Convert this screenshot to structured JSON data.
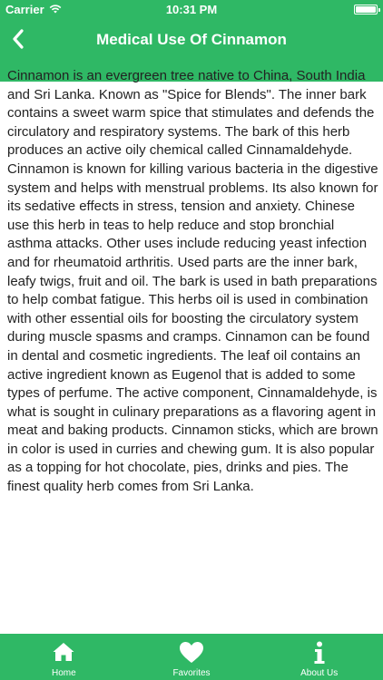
{
  "status_bar": {
    "carrier": "Carrier",
    "time": "10:31 PM",
    "wifi_icon": "wifi-icon",
    "battery_icon": "battery-icon"
  },
  "nav": {
    "title": "Medical Use Of Cinnamon",
    "back_icon": "chevron-left-icon"
  },
  "article": {
    "body": "Cinnamon is an evergreen tree native to China, South India and Sri Lanka. Known as \"Spice for Blends\". The inner bark contains a sweet warm spice that stimulates and defends the circulatory and respiratory systems. The bark of this herb produces an active oily chemical called Cinnamaldehyde. Cinnamon is known for killing various bacteria in the digestive system and helps with menstrual problems. Its also known for its sedative effects in stress, tension and anxiety. Chinese use this herb in teas to help reduce and stop bronchial asthma attacks. Other uses include reducing yeast infection and for rheumatoid arthritis. Used parts are the inner bark, leafy twigs, fruit and oil. The bark is used in bath preparations to help combat fatigue. This herbs oil is used in combination with other essential oils for boosting the circulatory system during muscle spasms and cramps. Cinnamon can be found in dental and cosmetic ingredients. The leaf oil contains an active ingredient known as Eugenol that is added to some types of perfume. The active component, Cinnamaldehyde, is what is sought in culinary preparations as a flavoring agent in meat and baking products. Cinnamon sticks, which are brown in color is used in curries and chewing gum. It is also popular as a topping for hot chocolate, pies, drinks and pies. The finest quality herb comes from Sri Lanka."
  },
  "tabbar": {
    "tabs": [
      {
        "label": "Home",
        "icon": "home-icon"
      },
      {
        "label": "Favorites",
        "icon": "heart-icon"
      },
      {
        "label": "About Us",
        "icon": "info-icon"
      }
    ]
  },
  "colors": {
    "accent": "#2fb865",
    "text": "#222222",
    "background": "#ffffff"
  }
}
